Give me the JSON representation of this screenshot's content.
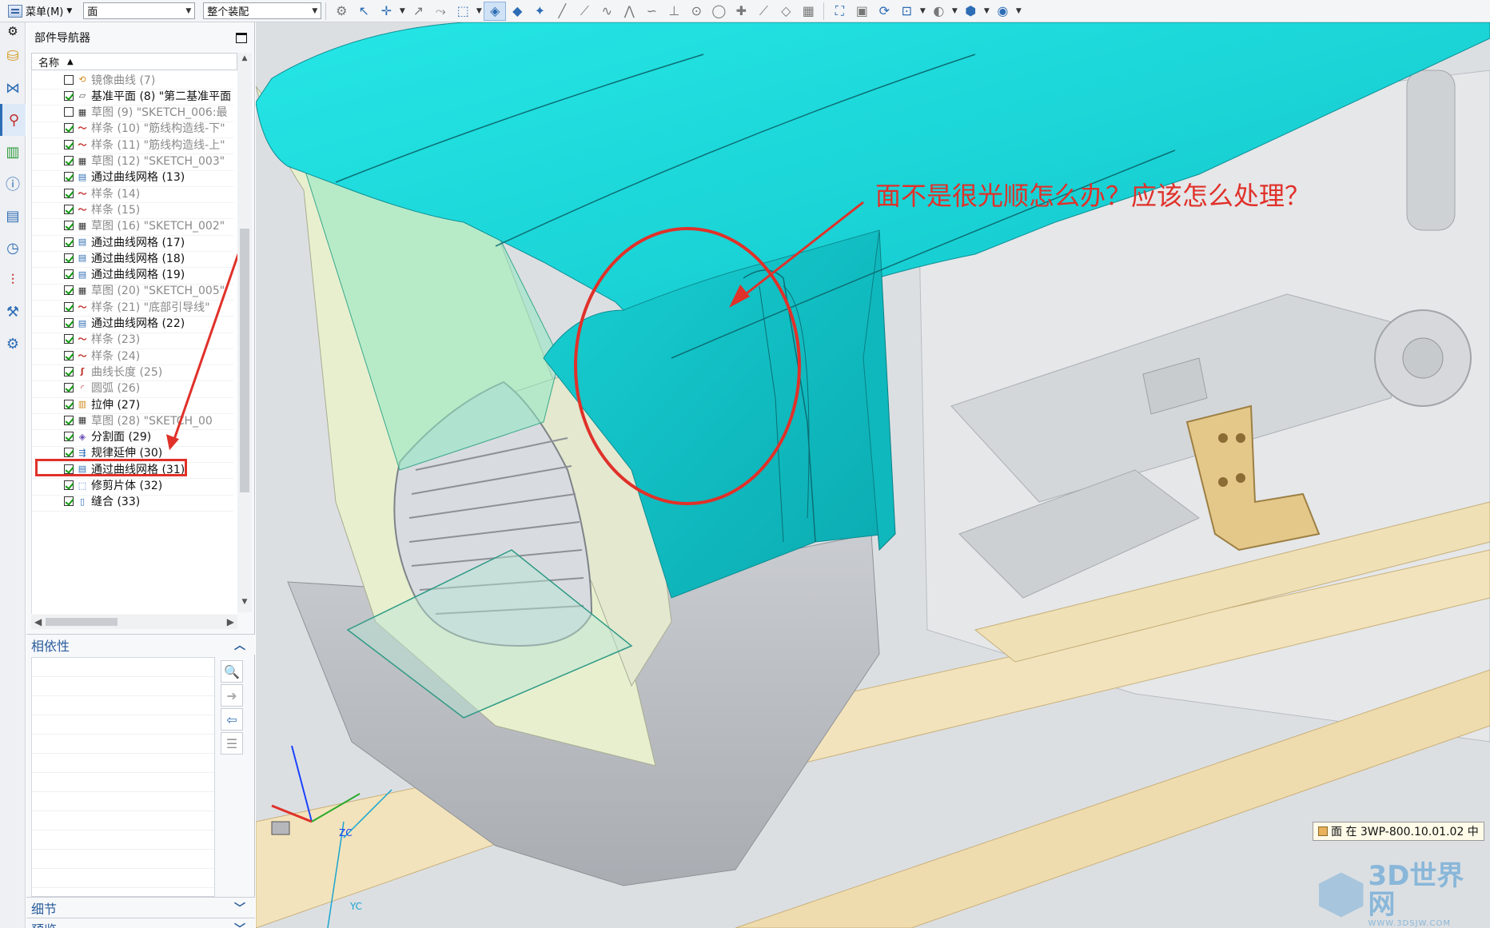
{
  "toolbar": {
    "menu_label": "菜单(M)",
    "filter_value": "面",
    "scope_value": "整个装配"
  },
  "navigator": {
    "title": "部件导航器",
    "column_name": "名称",
    "items": [
      {
        "label": "镜像曲线 (7)",
        "checked": false,
        "dim": true,
        "icon": "mirror-curve"
      },
      {
        "label": "基准平面 (8) \"第二基准平面",
        "checked": true,
        "dim": false,
        "icon": "datum-plane"
      },
      {
        "label": "草图 (9) \"SKETCH_006:最",
        "checked": false,
        "dim": true,
        "icon": "sketch"
      },
      {
        "label": "样条 (10) \"筋线构造线-下\"",
        "checked": true,
        "dim": true,
        "icon": "spline"
      },
      {
        "label": "样条 (11) \"筋线构造线-上\"",
        "checked": true,
        "dim": true,
        "icon": "spline"
      },
      {
        "label": "草图 (12) \"SKETCH_003\"",
        "checked": true,
        "dim": true,
        "icon": "sketch"
      },
      {
        "label": "通过曲线网格 (13)",
        "checked": true,
        "dim": false,
        "icon": "curve-mesh"
      },
      {
        "label": "样条 (14)",
        "checked": true,
        "dim": true,
        "icon": "spline"
      },
      {
        "label": "样条 (15)",
        "checked": true,
        "dim": true,
        "icon": "spline"
      },
      {
        "label": "草图 (16) \"SKETCH_002\"",
        "checked": true,
        "dim": true,
        "icon": "sketch"
      },
      {
        "label": "通过曲线网格 (17)",
        "checked": true,
        "dim": false,
        "icon": "curve-mesh"
      },
      {
        "label": "通过曲线网格 (18)",
        "checked": true,
        "dim": false,
        "icon": "curve-mesh"
      },
      {
        "label": "通过曲线网格 (19)",
        "checked": true,
        "dim": false,
        "icon": "curve-mesh"
      },
      {
        "label": "草图 (20) \"SKETCH_005\"",
        "checked": true,
        "dim": true,
        "icon": "sketch"
      },
      {
        "label": "样条 (21) \"底部引导线\"",
        "checked": true,
        "dim": true,
        "icon": "spline"
      },
      {
        "label": "通过曲线网格 (22)",
        "checked": true,
        "dim": false,
        "icon": "curve-mesh"
      },
      {
        "label": "样条 (23)",
        "checked": true,
        "dim": true,
        "icon": "spline"
      },
      {
        "label": "样条 (24)",
        "checked": true,
        "dim": true,
        "icon": "spline"
      },
      {
        "label": "曲线长度 (25)",
        "checked": true,
        "dim": true,
        "icon": "curve-length"
      },
      {
        "label": "圆弧 (26)",
        "checked": true,
        "dim": true,
        "icon": "arc"
      },
      {
        "label": "拉伸 (27)",
        "checked": true,
        "dim": false,
        "icon": "extrude"
      },
      {
        "label": "草图 (28) \"SKETCH_00",
        "checked": true,
        "dim": true,
        "icon": "sketch"
      },
      {
        "label": "分割面 (29)",
        "checked": true,
        "dim": false,
        "icon": "divide-face"
      },
      {
        "label": "规律延伸 (30)",
        "checked": true,
        "dim": false,
        "icon": "law-extension"
      },
      {
        "label": "通过曲线网格 (31)",
        "checked": true,
        "dim": false,
        "icon": "curve-mesh"
      },
      {
        "label": "修剪片体 (32)",
        "checked": true,
        "dim": false,
        "icon": "trim-sheet"
      },
      {
        "label": "缝合 (33)",
        "checked": true,
        "dim": false,
        "icon": "sew"
      }
    ],
    "highlight_index": 24
  },
  "panels": {
    "dependencies": "相依性",
    "details": "细节",
    "preview": "预览"
  },
  "viewport": {
    "annotation": "面不是很光顺怎么办？应该怎么处理？",
    "status_tip": "面 在 3WP-800.10.01.02 中",
    "triad_labels": {
      "z": "ZC",
      "y": "YC"
    },
    "watermark_main": "3D世界网",
    "watermark_sub": "WWW.3DSJW.COM"
  },
  "colors": {
    "highlight_red": "#e0312a",
    "surface_cyan": "#19d3d6",
    "accent_blue": "#2d6db5"
  }
}
